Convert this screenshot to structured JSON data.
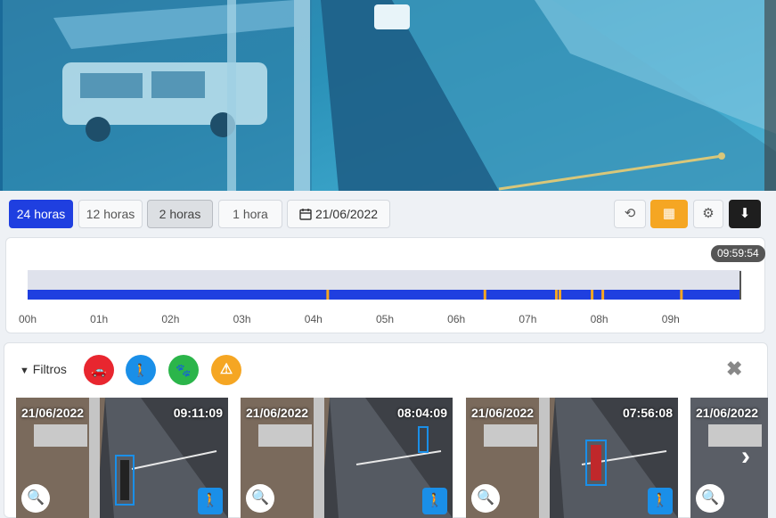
{
  "range_buttons": [
    {
      "label": "24 horas",
      "state": "active"
    },
    {
      "label": "12 horas",
      "state": "normal"
    },
    {
      "label": "2 horas",
      "state": "pressed"
    },
    {
      "label": "1 hora",
      "state": "normal"
    }
  ],
  "date_picker": {
    "icon": "calendar-icon",
    "value": "21/06/2022"
  },
  "toolbar_actions": [
    {
      "icon": "history-icon",
      "glyph": "⟲"
    },
    {
      "icon": "camera-grid-icon",
      "glyph": "▦",
      "color": "#f5a623"
    },
    {
      "icon": "gear-icon",
      "glyph": "⚙"
    },
    {
      "icon": "download-icon",
      "glyph": "⬇",
      "color": "#1e1e1e"
    }
  ],
  "timeline": {
    "current_time": "09:59:54",
    "hours": [
      "00h",
      "01h",
      "02h",
      "03h",
      "04h",
      "05h",
      "06h",
      "07h",
      "08h",
      "09h"
    ],
    "bar_color": "#1f3fe0",
    "marker_color": "#f5a623",
    "event_hours": [
      4.2,
      6.4,
      7.4,
      7.45,
      7.9,
      8.05,
      9.15
    ]
  },
  "filters": {
    "title": "Filtros",
    "items": [
      {
        "icon": "car-icon",
        "glyph": "🚗",
        "color": "#e8262f"
      },
      {
        "icon": "person-icon",
        "glyph": "🚶",
        "color": "#1a8fe8"
      },
      {
        "icon": "paw-icon",
        "glyph": "🐾",
        "color": "#2bb54a"
      },
      {
        "icon": "warning-icon",
        "glyph": "⚠",
        "color": "#f5a623"
      }
    ],
    "close_glyph": "✖"
  },
  "events": [
    {
      "date": "21/06/2022",
      "time": "09:11:09"
    },
    {
      "date": "21/06/2022",
      "time": "08:04:09"
    },
    {
      "date": "21/06/2022",
      "time": "07:56:08"
    },
    {
      "date": "21/06/2022",
      "time": ""
    }
  ],
  "zoom_glyph": "🔍",
  "person_glyph": "🚶",
  "next_glyph": "›"
}
